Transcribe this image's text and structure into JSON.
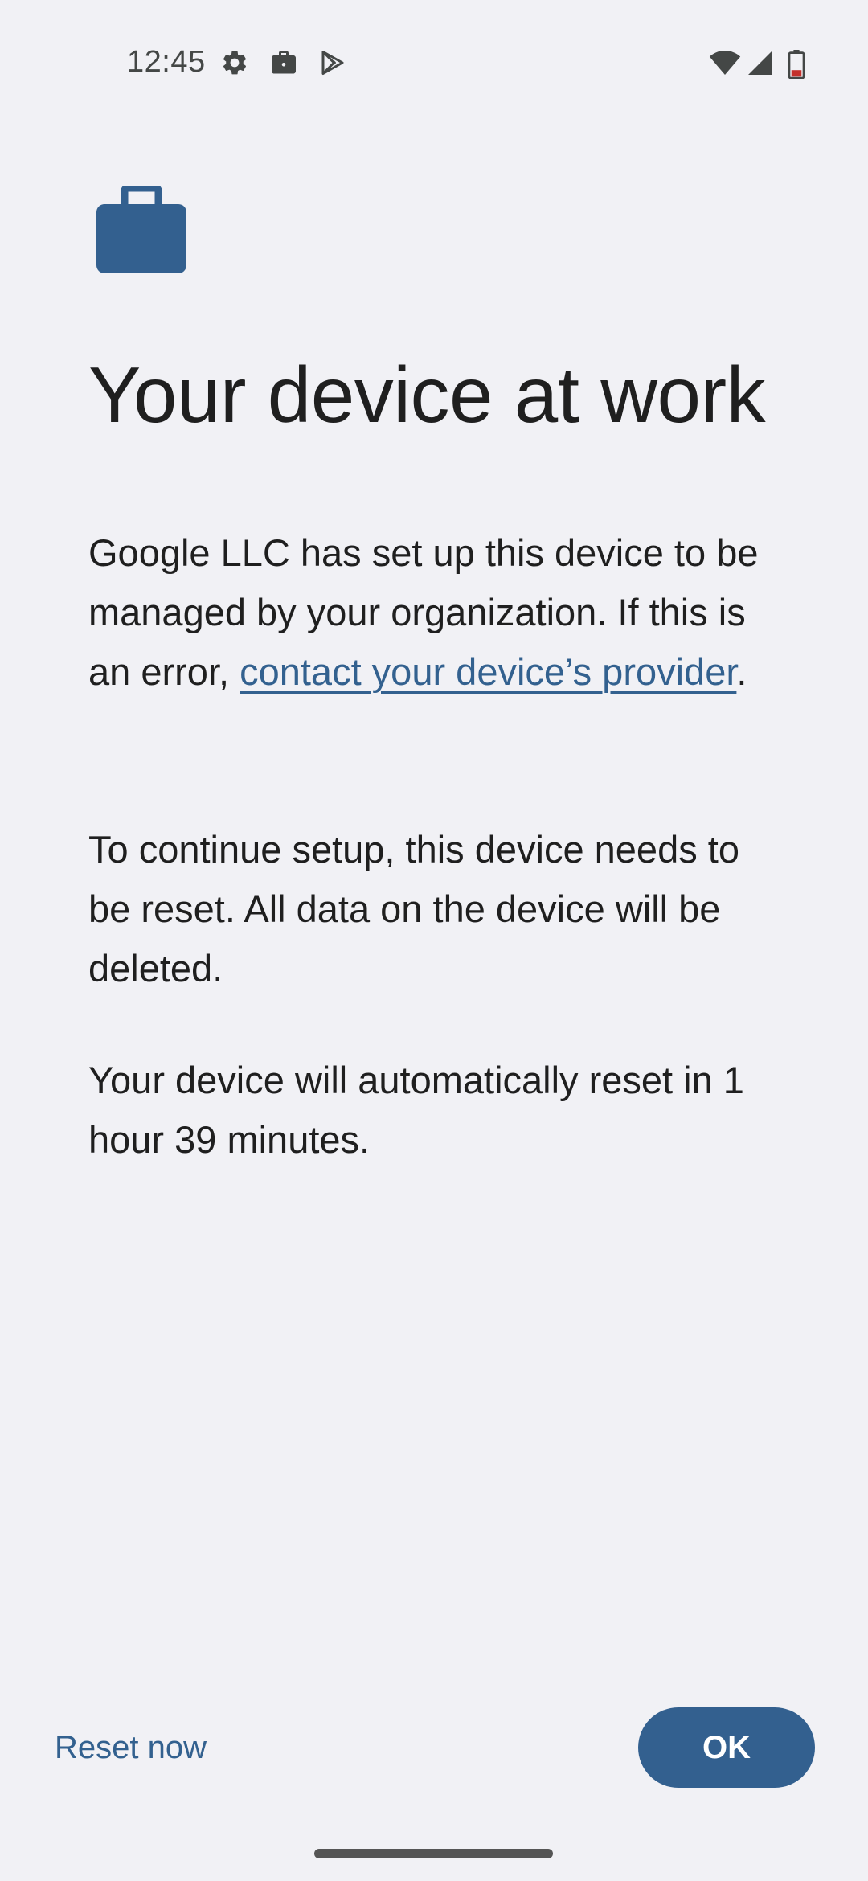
{
  "status_bar": {
    "time": "12:45",
    "icons": [
      "settings-icon",
      "work-briefcase-icon",
      "play-store-icon",
      "wifi-icon",
      "cellular-signal-icon",
      "battery-icon"
    ]
  },
  "header": {
    "icon": "work-briefcase-icon",
    "title": "Your device at work"
  },
  "body": {
    "para1_text": "Google LLC has set up this device to be managed by your organization. If this is an error, ",
    "para1_link": "contact your device’s provider",
    "para1_end": ".",
    "para2": "To continue setup, this device needs to be reset. All data on the device will be deleted.",
    "para3": "Your device will automatically reset in 1 hour 39 minutes."
  },
  "actions": {
    "reset_label": "Reset now",
    "ok_label": "OK"
  },
  "colors": {
    "background": "#f1f1f5",
    "accent": "#33608f",
    "text": "#1f1f1f"
  }
}
